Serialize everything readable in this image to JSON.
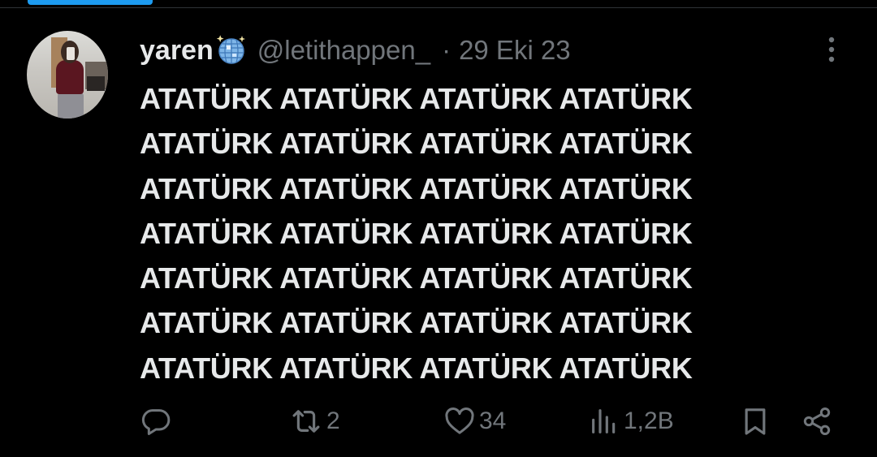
{
  "tweet": {
    "display_name": "yaren",
    "handle": "@letithappen_",
    "separator": "·",
    "date": "29 Eki 23",
    "name_emoji": "mirror-ball-icon",
    "lines": [
      "ATATÜRK ATATÜRK ATATÜRK ATATÜRK",
      "ATATÜRK ATATÜRK ATATÜRK ATATÜRK",
      "ATATÜRK ATATÜRK ATATÜRK ATATÜRK",
      "ATATÜRK ATATÜRK ATATÜRK ATATÜRK",
      "ATATÜRK ATATÜRK ATATÜRK ATATÜRK",
      "ATATÜRK ATATÜRK ATATÜRK ATATÜRK",
      "ATATÜRK ATATÜRK ATATÜRK ATATÜRK"
    ]
  },
  "actions": {
    "reply": {
      "icon": "reply-icon",
      "count": ""
    },
    "retweet": {
      "icon": "retweet-icon",
      "count": "2"
    },
    "like": {
      "icon": "heart-icon",
      "count": "34"
    },
    "views": {
      "icon": "views-icon",
      "count": "1,2B"
    },
    "bookmark": {
      "icon": "bookmark-icon"
    },
    "share": {
      "icon": "share-icon"
    }
  },
  "colors": {
    "background": "#000000",
    "text_primary": "#e7e9ea",
    "text_secondary": "#71767b",
    "accent": "#1d9bf0",
    "divider": "#2f3336"
  }
}
